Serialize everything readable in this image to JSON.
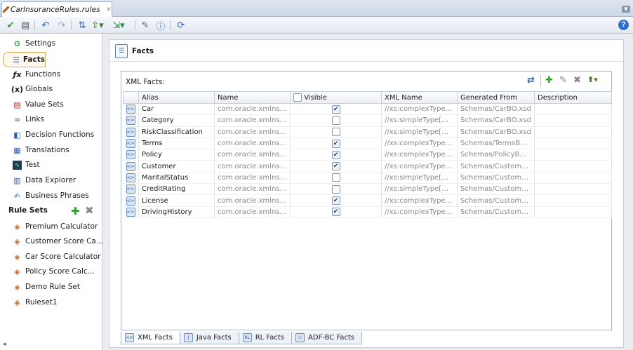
{
  "document_tab": {
    "title": "CarInsuranceRules.rules",
    "close": "×"
  },
  "toolbar": {
    "help": "?"
  },
  "sidebar": {
    "items": [
      {
        "label": "Settings",
        "icon": "settings-icon"
      },
      {
        "label": "Facts",
        "icon": "facts-icon"
      },
      {
        "label": "Functions",
        "icon": "functions-icon"
      },
      {
        "label": "Globals",
        "icon": "globals-icon"
      },
      {
        "label": "Value Sets",
        "icon": "value-sets-icon"
      },
      {
        "label": "Links",
        "icon": "links-icon"
      },
      {
        "label": "Decision Functions",
        "icon": "decision-functions-icon"
      },
      {
        "label": "Translations",
        "icon": "translations-icon"
      },
      {
        "label": "Test",
        "icon": "test-icon"
      },
      {
        "label": "Data Explorer",
        "icon": "data-explorer-icon"
      },
      {
        "label": "Business Phrases",
        "icon": "business-phrases-icon"
      }
    ],
    "rule_sets_header": "Rule Sets",
    "rule_sets": [
      {
        "label": "Premium Calculator"
      },
      {
        "label": "Customer Score Ca..."
      },
      {
        "label": "Car Score Calculator"
      },
      {
        "label": "Policy Score Calc..."
      },
      {
        "label": "Demo Rule Set"
      },
      {
        "label": "Ruleset1"
      }
    ]
  },
  "main": {
    "title": "Facts",
    "panel_label": "XML Facts:",
    "columns": [
      "Alias",
      "Name",
      "Visible",
      "XML Name",
      "Generated From",
      "Description"
    ],
    "rows": [
      {
        "alias": "Car",
        "name": "com.oracle.xmlns.b...",
        "visible": true,
        "xml_name": "//xs:complexType[...",
        "generated_from": "Schemas/CarBO.xsd",
        "description": ""
      },
      {
        "alias": "Category",
        "name": "com.oracle.xmlns.b...",
        "visible": false,
        "xml_name": "//xs:simpleType[@n...",
        "generated_from": "Schemas/CarBO.xsd",
        "description": ""
      },
      {
        "alias": "RiskClassification",
        "name": "com.oracle.xmlns.b...",
        "visible": false,
        "xml_name": "//xs:simpleType[@n...",
        "generated_from": "Schemas/CarBO.xsd",
        "description": ""
      },
      {
        "alias": "Terms",
        "name": "com.oracle.xmlns.b...",
        "visible": true,
        "xml_name": "//xs:complexType[...",
        "generated_from": "Schemas/TermsBO....",
        "description": ""
      },
      {
        "alias": "Policy",
        "name": "com.oracle.xmlns.b...",
        "visible": true,
        "xml_name": "//xs:complexType[...",
        "generated_from": "Schemas/PolicyBO.x...",
        "description": ""
      },
      {
        "alias": "Customer",
        "name": "com.oracle.xmlns.b...",
        "visible": true,
        "xml_name": "//xs:complexType[...",
        "generated_from": "Schemas/Customer...",
        "description": ""
      },
      {
        "alias": "MaritalStatus",
        "name": "com.oracle.xmlns.b...",
        "visible": false,
        "xml_name": "//xs:simpleType[@n...",
        "generated_from": "Schemas/Customer...",
        "description": ""
      },
      {
        "alias": "CreditRating",
        "name": "com.oracle.xmlns.b...",
        "visible": false,
        "xml_name": "//xs:simpleType[@n...",
        "generated_from": "Schemas/Customer...",
        "description": ""
      },
      {
        "alias": "License",
        "name": "com.oracle.xmlns.b...",
        "visible": true,
        "xml_name": "//xs:complexType[...",
        "generated_from": "Schemas/Customer...",
        "description": ""
      },
      {
        "alias": "DrivingHistory",
        "name": "com.oracle.xmlns.b...",
        "visible": true,
        "xml_name": "//xs:complexType[...",
        "generated_from": "Schemas/Customer...",
        "description": ""
      }
    ],
    "bottom_tabs": [
      {
        "label": "XML Facts",
        "active": true
      },
      {
        "label": "Java Facts",
        "active": false
      },
      {
        "label": "RL Facts",
        "active": false
      },
      {
        "label": "ADF-BC Facts",
        "active": false
      }
    ]
  },
  "colors": {
    "accent_green": "#2aa52a",
    "selected_border": "#e0a64a",
    "help_blue": "#2c6fd1"
  }
}
